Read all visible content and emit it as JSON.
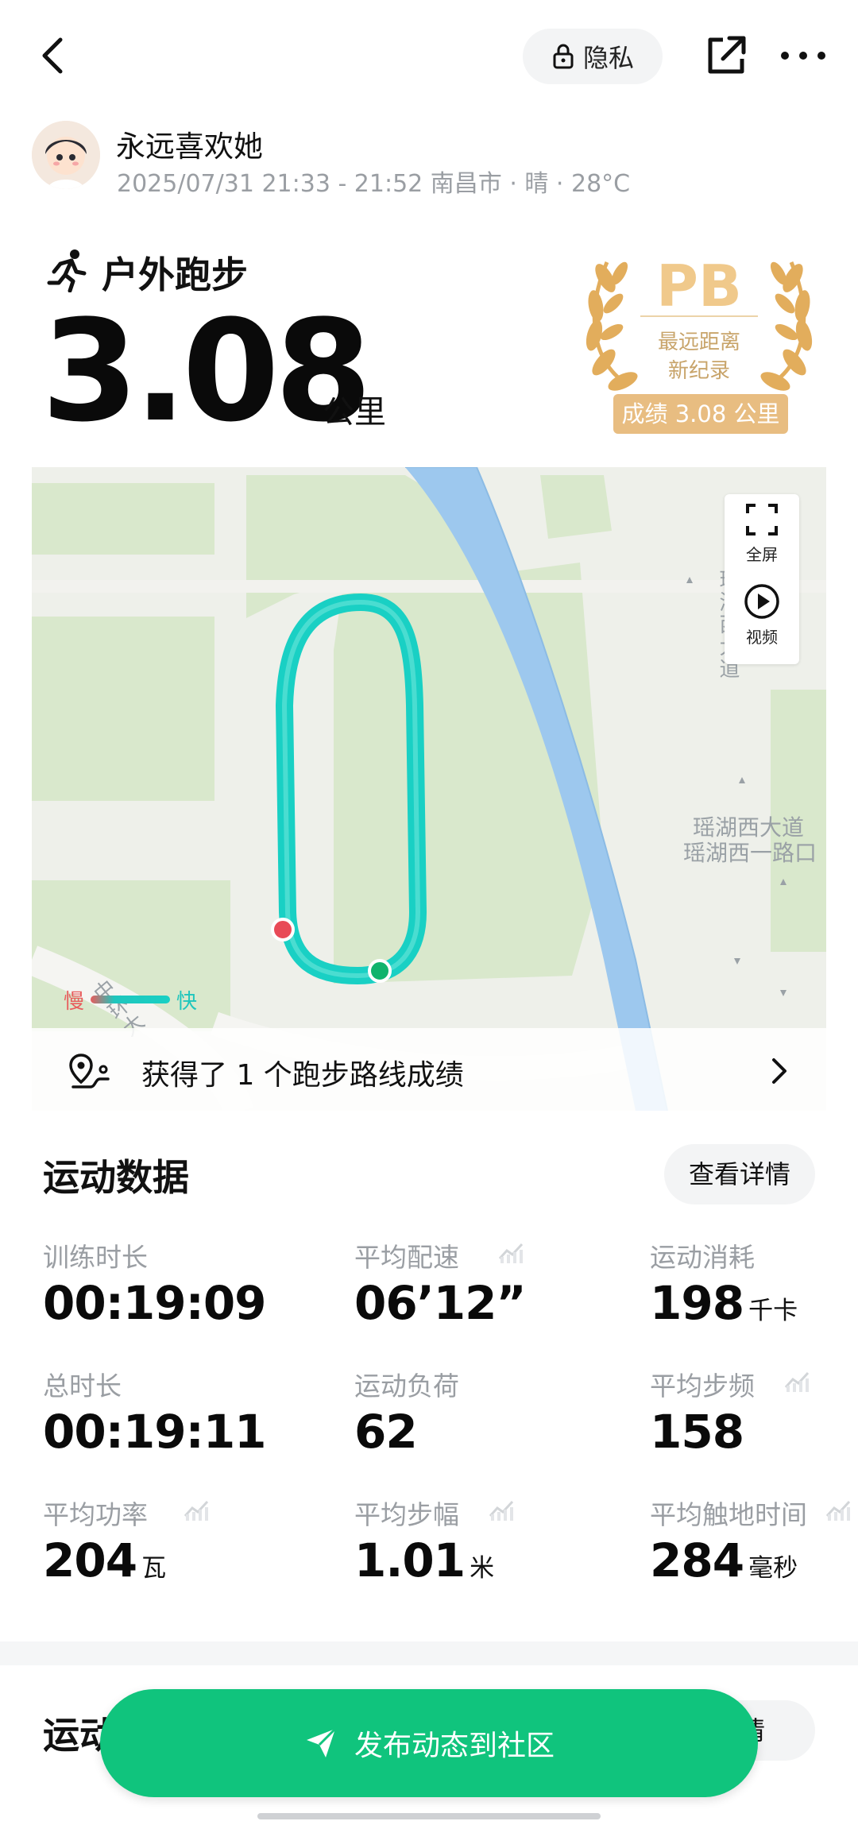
{
  "header": {
    "privacy_label": "隐私"
  },
  "user": {
    "name": "永远喜欢她",
    "meta": "2025/07/31 21:33 - 21:52 南昌市 · 晴 · 28°C"
  },
  "activity": {
    "type": "户外跑步",
    "distance": "3.08",
    "distance_unit": "公里"
  },
  "pb_badge": {
    "title": "PB",
    "line1": "最远距离",
    "line2": "新纪录",
    "result": "成绩 3.08 公里"
  },
  "map": {
    "controls": {
      "fullscreen": "全屏",
      "video": "视频"
    },
    "roads": {
      "vertical": "瑶湖西大道",
      "label1": "瑶湖西大道",
      "label2": "瑶湖西一路口",
      "left": "中环大"
    },
    "legend": {
      "slow": "慢",
      "fast": "快"
    },
    "route_message": "获得了 1 个跑步路线成绩",
    "colors": {
      "route": "#19d0c4",
      "start_marker": "#e84a57",
      "end_marker": "#10b36c",
      "water": "#9dc8ee",
      "park": "#d8e8c9"
    }
  },
  "stats": {
    "title": "运动数据",
    "detail_button": "查看详情",
    "items": [
      {
        "label": "训练时长",
        "value": "00:19:09",
        "unit": ""
      },
      {
        "label": "平均配速",
        "value": "06’12”",
        "unit": ""
      },
      {
        "label": "运动消耗",
        "value": "198",
        "unit": "千卡"
      },
      {
        "label": "总时长",
        "value": "00:19:11",
        "unit": ""
      },
      {
        "label": "运动负荷",
        "value": "62",
        "unit": ""
      },
      {
        "label": "平均步频",
        "value": "158",
        "unit": ""
      },
      {
        "label": "平均功率",
        "value": "204",
        "unit": "瓦"
      },
      {
        "label": "平均步幅",
        "value": "1.01",
        "unit": "米"
      },
      {
        "label": "平均触地时间",
        "value": "284",
        "unit": "毫秒"
      }
    ]
  },
  "section2": {
    "title": "运动",
    "button": "详情"
  },
  "publish_button": "发布动态到社区",
  "accent_color": "#10c47d"
}
